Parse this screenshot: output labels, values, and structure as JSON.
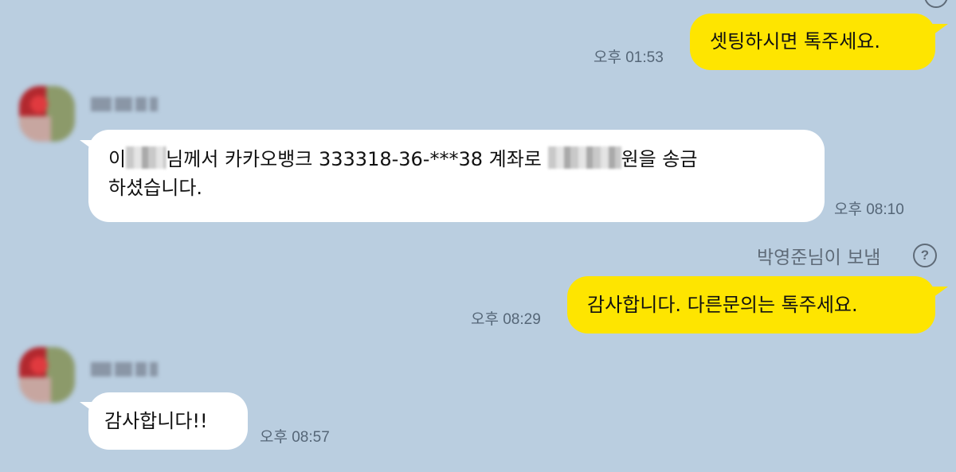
{
  "messages": [
    {
      "id": "m1",
      "side": "mine",
      "text": "셋팅하시면 톡주세요.",
      "time": "오후 01:53"
    },
    {
      "id": "m2",
      "side": "theirs",
      "sender_name_redacted": true,
      "text_line1_part1": "이",
      "text_line1_part2": "님께서 카카오뱅크 333318-36-***38 계좌로 ",
      "text_line1_part3": "원을 송금",
      "text_line2": "하셨습니다.",
      "time": "오후 08:10"
    },
    {
      "id": "m3",
      "side": "mine",
      "sent_by": "박영준님이 보냄",
      "help_icon": "question-circle-icon",
      "text": "감사합니다. 다른문의는 톡주세요.",
      "time": "오후 08:29"
    },
    {
      "id": "m4",
      "side": "theirs",
      "sender_name_redacted": true,
      "text": "감사합니다!!",
      "time": "오후 08:57"
    }
  ],
  "colors": {
    "background": "#bacee0",
    "my_bubble": "#fee500",
    "their_bubble": "#ffffff"
  }
}
